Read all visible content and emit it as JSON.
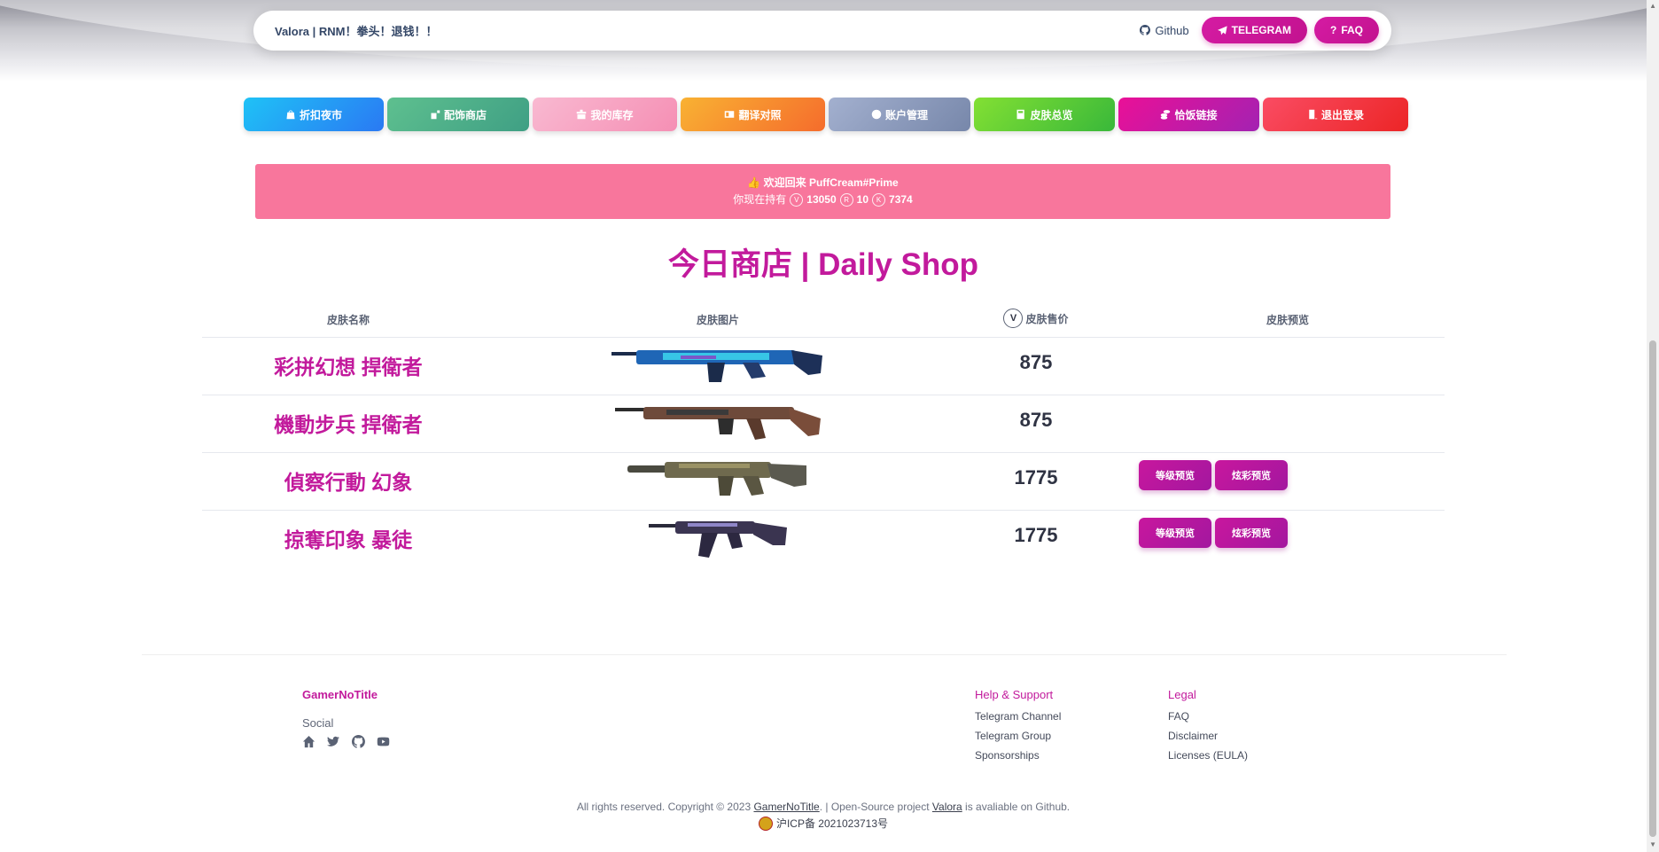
{
  "navbar": {
    "brand": "Valora | RNM！拳头！退钱！！",
    "github_label": "Github",
    "telegram_label": "TELEGRAM",
    "faq_label": "FAQ"
  },
  "menu": [
    {
      "label": "折扣夜市",
      "icon": "shopping-bag-icon",
      "color_from": "#1fc2f6",
      "color_to": "#2a79f3"
    },
    {
      "label": "配饰商店",
      "icon": "accessory-icon",
      "color_from": "#5ec08f",
      "color_to": "#3f9f84"
    },
    {
      "label": "我的库存",
      "icon": "inventory-icon",
      "color_from": "#f9b9d1",
      "color_to": "#f58fb4"
    },
    {
      "label": "翻译对照",
      "icon": "translate-icon",
      "color_from": "#f9b233",
      "color_to": "#f56c2c"
    },
    {
      "label": "账户管理",
      "icon": "user-icon",
      "color_from": "#a3b0cf",
      "color_to": "#7787aa"
    },
    {
      "label": "皮肤总览",
      "icon": "book-icon",
      "color_from": "#83e033",
      "color_to": "#39b83a"
    },
    {
      "label": "恰饭链接",
      "icon": "coins-icon",
      "color_from": "#ea1097",
      "color_to": "#a322b2"
    },
    {
      "label": "退出登录",
      "icon": "door-icon",
      "color_from": "#fa4c63",
      "color_to": "#ec2526"
    }
  ],
  "alert": {
    "welcome": "欢迎回来 PuffCream#Prime",
    "holding_prefix": "你现在持有",
    "vp": "13050",
    "rp": "10",
    "kc": "7374"
  },
  "shop": {
    "title": "今日商店 | Daily Shop",
    "headers": {
      "name": "皮肤名称",
      "image": "皮肤图片",
      "price": "皮肤售价",
      "preview": "皮肤预览"
    },
    "items": [
      {
        "name": "彩拼幻想 捍衛者",
        "price": "875",
        "has_preview": false,
        "gun": "defender-1"
      },
      {
        "name": "機動步兵 捍衛者",
        "price": "875",
        "has_preview": false,
        "gun": "defender-2"
      },
      {
        "name": "偵察行動 幻象",
        "price": "1775",
        "has_preview": true,
        "gun": "phantom"
      },
      {
        "name": "掠奪印象 暴徒",
        "price": "1775",
        "has_preview": true,
        "gun": "vandal"
      }
    ],
    "preview_level_label": "等级预览",
    "preview_chroma_label": "炫彩预览"
  },
  "footer": {
    "brand": "GamerNoTitle",
    "social_label": "Social",
    "help_title": "Help & Support",
    "help_links": [
      "Telegram Channel",
      "Telegram Group",
      "Sponsorships"
    ],
    "legal_title": "Legal",
    "legal_links": [
      "FAQ",
      "Disclaimer",
      "Licenses (EULA)"
    ],
    "copy_prefix": "All rights reserved. Copyright © 2023",
    "copy_owner": "GamerNoTitle",
    "copy_mid": ". | Open-Source project",
    "copy_project": "Valora",
    "copy_suffix": "is avaliable on Github.",
    "icp": "沪ICP备 2021023713号"
  }
}
